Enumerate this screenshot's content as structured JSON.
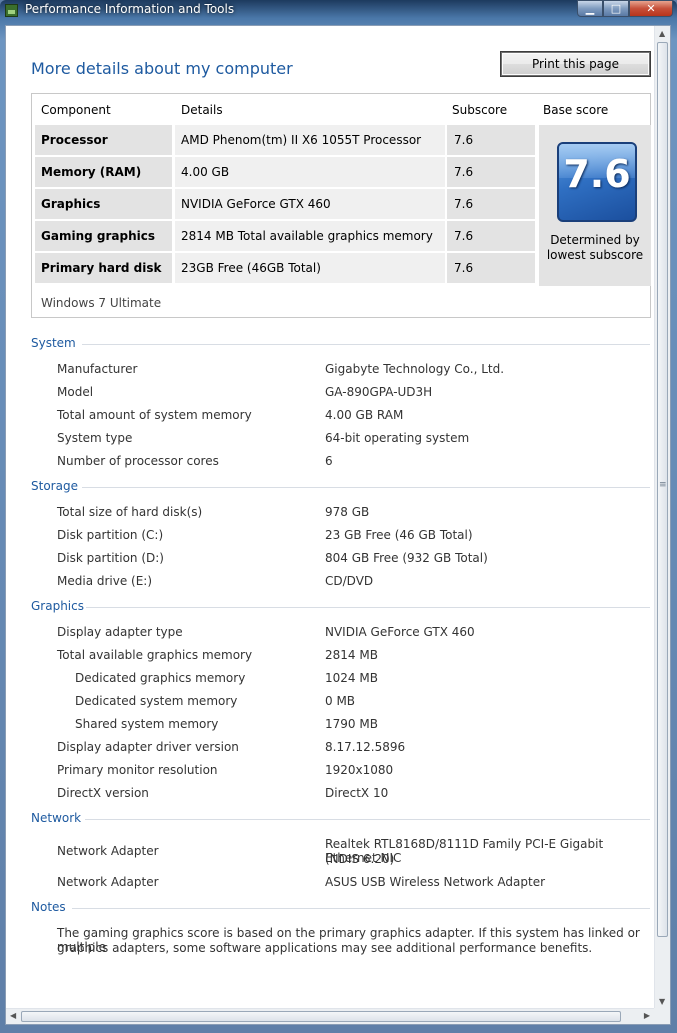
{
  "window": {
    "title": "Performance Information and Tools"
  },
  "page": {
    "heading": "More details about my computer",
    "print_button": "Print this page"
  },
  "score_table": {
    "headers": {
      "component": "Component",
      "details": "Details",
      "subscore": "Subscore",
      "base_score": "Base score"
    },
    "rows": [
      {
        "component": "Processor",
        "details": "AMD Phenom(tm) II X6 1055T Processor",
        "subscore": "7.6"
      },
      {
        "component": "Memory (RAM)",
        "details": "4.00 GB",
        "subscore": "7.6"
      },
      {
        "component": "Graphics",
        "details": "NVIDIA GeForce GTX 460",
        "subscore": "7.6"
      },
      {
        "component": "Gaming graphics",
        "details": "2814 MB Total available graphics memory",
        "subscore": "7.6"
      },
      {
        "component": "Primary hard disk",
        "details": "23GB Free (46GB Total)",
        "subscore": "7.6"
      }
    ],
    "base_score": "7.6",
    "determined_line1": "Determined by",
    "determined_line2": "lowest subscore",
    "os": "Windows 7 Ultimate"
  },
  "system": {
    "title": "System",
    "items": [
      {
        "label": "Manufacturer",
        "value": "Gigabyte Technology Co., Ltd."
      },
      {
        "label": "Model",
        "value": "GA-890GPA-UD3H"
      },
      {
        "label": "Total amount of system memory",
        "value": "4.00 GB RAM"
      },
      {
        "label": "System type",
        "value": "64-bit operating system"
      },
      {
        "label": "Number of processor cores",
        "value": "6"
      }
    ]
  },
  "storage": {
    "title": "Storage",
    "items": [
      {
        "label": "Total size of hard disk(s)",
        "value": "978 GB"
      },
      {
        "label": "Disk partition (C:)",
        "value": "23 GB Free (46 GB Total)"
      },
      {
        "label": "Disk partition (D:)",
        "value": "804 GB Free (932 GB Total)"
      },
      {
        "label": "Media drive (E:)",
        "value": "CD/DVD"
      }
    ]
  },
  "graphics": {
    "title": "Graphics",
    "items": [
      {
        "label": "Display adapter type",
        "value": "NVIDIA GeForce GTX 460"
      },
      {
        "label": "Total available graphics memory",
        "value": "2814 MB"
      },
      {
        "label": "Dedicated graphics memory",
        "value": "1024 MB"
      },
      {
        "label": "Dedicated system memory",
        "value": "0 MB"
      },
      {
        "label": "Shared system memory",
        "value": "1790 MB"
      },
      {
        "label": "Display adapter driver version",
        "value": "8.17.12.5896"
      },
      {
        "label": "Primary monitor resolution",
        "value": "1920x1080"
      },
      {
        "label": "DirectX version",
        "value": "DirectX 10"
      }
    ]
  },
  "network": {
    "title": "Network",
    "items": [
      {
        "label": "Network Adapter",
        "value_line1": "Realtek RTL8168D/8111D Family PCI-E Gigabit Ethernet NIC",
        "value_line2": "(NDIS 6.20)"
      },
      {
        "label": "Network Adapter",
        "value": "ASUS USB Wireless Network Adapter"
      }
    ]
  },
  "notes": {
    "title": "Notes",
    "line1": "The gaming graphics score is based on the primary graphics adapter. If this system has linked or multiple",
    "line2": "graphics adapters, some software applications may see additional performance benefits."
  }
}
